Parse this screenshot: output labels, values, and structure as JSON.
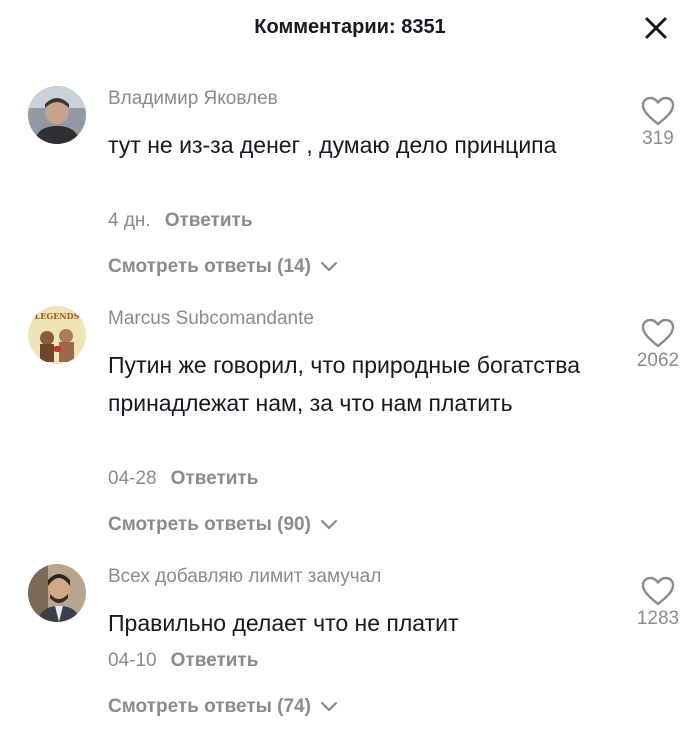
{
  "header": {
    "title": "Комментарии: 8351"
  },
  "comments": [
    {
      "username": "Владимир Яковлев",
      "text": "тут не из-за денег , думаю дело принципа",
      "date": "4 дн.",
      "reply_label": "Ответить",
      "view_replies_label": "Смотреть ответы (14)",
      "likes": "319"
    },
    {
      "username": "Marcus Subcomandante",
      "text": "Путин же говорил, что природные богатства принадлежат нам, за что нам платить",
      "date": "04-28",
      "reply_label": "Ответить",
      "view_replies_label": "Смотреть ответы (90)",
      "likes": "2062",
      "avatar_caption": "LEGENDS"
    },
    {
      "username": "Всех добавляю лимит замучал",
      "text": "Правильно делает что не платит",
      "date": "04-10",
      "reply_label": "Ответить",
      "view_replies_label": "Смотреть ответы (74)",
      "likes": "1283"
    }
  ],
  "icons": {
    "close": "close-icon",
    "like": "heart-outline-icon",
    "expand": "chevron-down-icon"
  },
  "colors": {
    "primary_text": "#161823",
    "secondary_text": "#8a8b91",
    "background": "#ffffff"
  }
}
